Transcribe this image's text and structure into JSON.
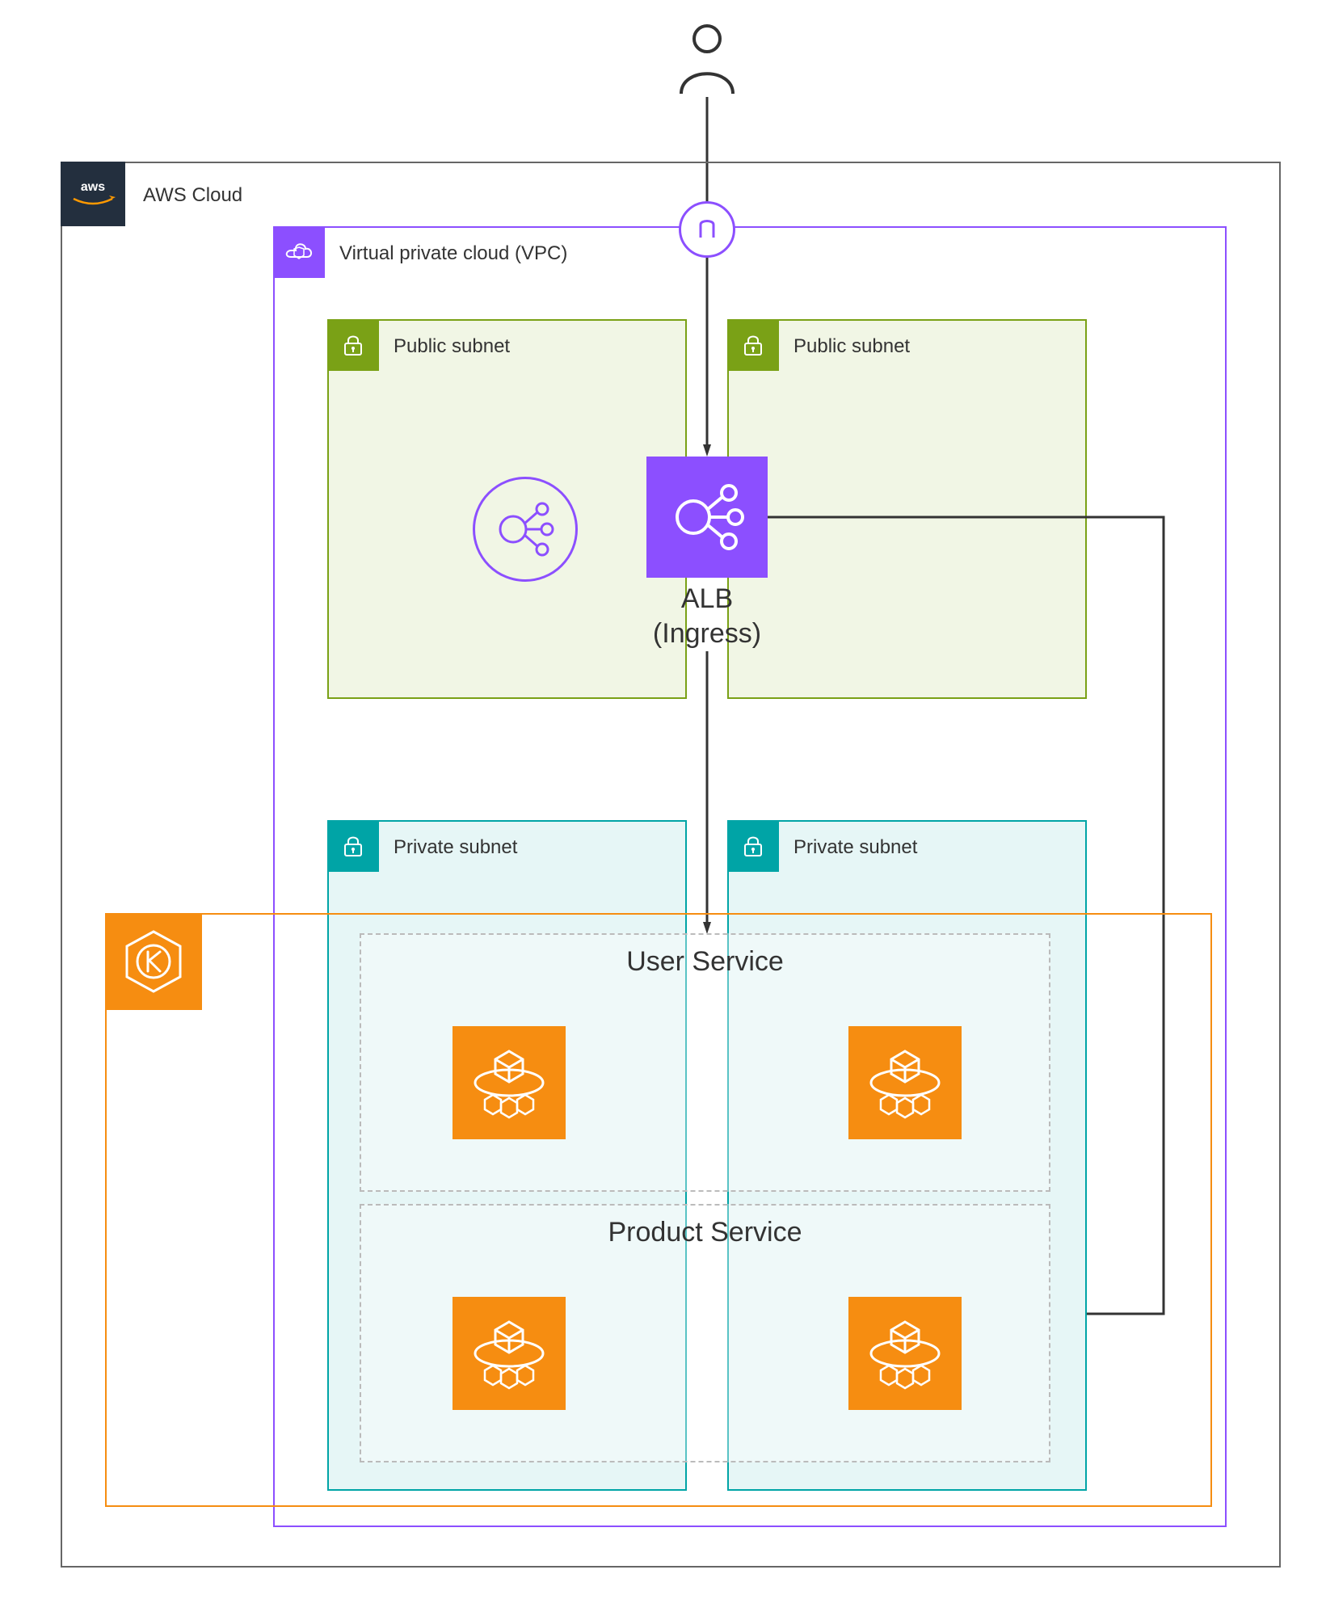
{
  "aws_cloud_label": "AWS Cloud",
  "vpc_label": "Virtual private cloud (VPC)",
  "public_subnet_label": "Public subnet",
  "private_subnet_label": "Private subnet",
  "alb_label_line1": "ALB",
  "alb_label_line2": "(Ingress)",
  "user_service_label": "User Service",
  "product_service_label": "Product Service",
  "colors": {
    "aws_black": "#232F3E",
    "vpc_purple": "#8C4FFF",
    "subnet_green_border": "#7AA116",
    "subnet_green_fill": "#F1F6E5",
    "subnet_teal_border": "#00A4A6",
    "subnet_teal_fill": "#E6F5F6",
    "orange": "#F68D11",
    "gray_border": "#cccccc",
    "text": "#333333"
  },
  "icons": {
    "user": "user-icon",
    "aws_logo": "aws-logo-icon",
    "vpc_badge": "cloud-shield-icon",
    "subnet_lock": "lock-icon",
    "internet_gateway": "gateway-icon",
    "elastic_lb_outline": "load-balancer-outline-icon",
    "alb_filled": "load-balancer-icon",
    "eks_k": "kubernetes-icon",
    "ecs_pod": "container-pod-icon"
  }
}
